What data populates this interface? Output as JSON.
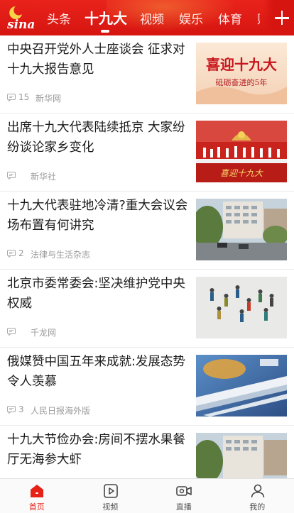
{
  "header": {
    "logo_text": "sina",
    "tabs": [
      {
        "label": "头条",
        "active": false
      },
      {
        "label": "十九大",
        "active": true
      },
      {
        "label": "视频",
        "active": false
      },
      {
        "label": "娱乐",
        "active": false
      },
      {
        "label": "体育",
        "active": false
      },
      {
        "label": "财",
        "active": false
      }
    ],
    "add_icon": "plus-icon",
    "brand_color": "#e2231a"
  },
  "feed": {
    "items": [
      {
        "title": "中央召开党外人士座谈会 征求对十九大报告意见",
        "comments": "15",
        "source": "新华网",
        "thumb_text": "喜迎十九大",
        "thumb_subtext": "砥砺奋进的5年"
      },
      {
        "title": "出席十九大代表陆续抵京 大家纷纷谈论家乡变化",
        "comments": "",
        "source": "新华社",
        "thumb_text": "喜迎十九大"
      },
      {
        "title": "十九大代表驻地冷清?重大会议会场布置有何讲究",
        "comments": "2",
        "source": "法律与生活杂志"
      },
      {
        "title": "北京市委常委会:坚决维护党中央权威",
        "comments": "",
        "source": "千龙网"
      },
      {
        "title": "俄媒赞中国五年来成就:发展态势令人羡慕",
        "comments": "3",
        "source": "人民日报海外版"
      },
      {
        "title": "十九大节俭办会:房间不摆水果餐厅无海参大虾",
        "comments": "",
        "source": ""
      }
    ]
  },
  "bottom_nav": {
    "items": [
      {
        "label": "首页",
        "icon": "home-icon",
        "active": true
      },
      {
        "label": "视频",
        "icon": "video-icon",
        "active": false
      },
      {
        "label": "直播",
        "icon": "live-camera-icon",
        "active": false
      },
      {
        "label": "我的",
        "icon": "profile-icon",
        "active": false
      }
    ],
    "active_color": "#e62117"
  }
}
